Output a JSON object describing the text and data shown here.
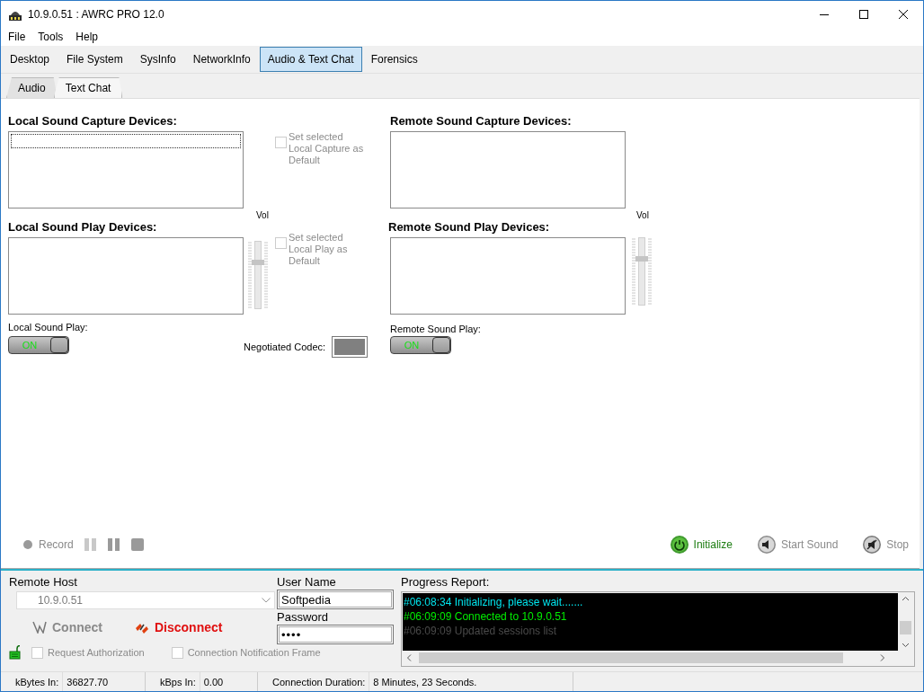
{
  "window": {
    "title": "10.9.0.51 : AWRC PRO 12.0"
  },
  "menu": [
    "File",
    "Tools",
    "Help"
  ],
  "tabs": [
    {
      "label": "Desktop",
      "selected": false
    },
    {
      "label": "File System",
      "selected": false
    },
    {
      "label": "SysInfo",
      "selected": false
    },
    {
      "label": "NetworkInfo",
      "selected": false
    },
    {
      "label": "Audio & Text Chat",
      "selected": true
    },
    {
      "label": "Forensics",
      "selected": false
    }
  ],
  "subtabs": [
    {
      "label": "Audio",
      "selected": true
    },
    {
      "label": "Text Chat",
      "selected": false
    }
  ],
  "local_capture": {
    "heading": "Local Sound Capture Devices:",
    "default_checkbox": {
      "label": "Set selected Local Capture as Default",
      "checked": false,
      "disabled": true
    }
  },
  "remote_capture": {
    "heading": "Remote Sound Capture Devices:"
  },
  "local_play": {
    "heading": "Local Sound Play Devices:",
    "vol_label": "Vol",
    "volume": {
      "level": 0.7
    },
    "default_checkbox": {
      "label": "Set selected Local Play as Default",
      "checked": false,
      "disabled": true
    },
    "toggle_label": "Local Sound Play:",
    "toggle": {
      "label": "ON",
      "on": true
    }
  },
  "remote_play": {
    "heading": "Remote Sound Play Devices:",
    "vol_label": "Vol",
    "volume": {
      "level": 0.7
    },
    "toggle_label": "Remote Sound Play:",
    "toggle": {
      "label": "ON",
      "on": true
    }
  },
  "codec": {
    "label": "Negotiated Codec:"
  },
  "toolbar": [
    {
      "kind": "record",
      "label": "Record",
      "disabled": true
    },
    {
      "kind": "pause-light",
      "disabled": true
    },
    {
      "kind": "pause",
      "disabled": true
    },
    {
      "kind": "stop-square",
      "disabled": true
    },
    {
      "kind": "initialize",
      "label": "Initialize",
      "disabled": false
    },
    {
      "kind": "start-sound",
      "label": "Start Sound",
      "disabled": true
    },
    {
      "kind": "stop",
      "label": "Stop",
      "disabled": true
    }
  ],
  "connection": {
    "host_label": "Remote Host",
    "host_value": "10.9.0.51",
    "connect": {
      "label": "Connect",
      "disabled": true
    },
    "disconnect": {
      "label": "Disconnect",
      "disabled": false
    },
    "options": [
      {
        "label": "Request Authorization",
        "checked": false,
        "disabled": true
      },
      {
        "label": "Connection Notification Frame",
        "checked": false,
        "disabled": true
      }
    ],
    "user_label": "User Name",
    "user_value": "Softpedia",
    "password_label": "Password",
    "password_value": "••••"
  },
  "progress": {
    "label": "Progress Report:",
    "lines": [
      {
        "text": "#06:08:34 Initializing, please wait.......",
        "color": "#00e5ee"
      },
      {
        "text": "#06:09:09 Connected to 10.9.0.51",
        "color": "#00ee00"
      },
      {
        "text": "#06:09:09 Updated sessions list",
        "color": "#4a4a4a"
      }
    ]
  },
  "status_bar": [
    {
      "label": "kBytes In:",
      "value": "36827.70"
    },
    {
      "label": "kBps In:",
      "value": "0.00"
    },
    {
      "label": "Connection Duration:",
      "value": "8 Minutes, 23 Seconds."
    }
  ]
}
